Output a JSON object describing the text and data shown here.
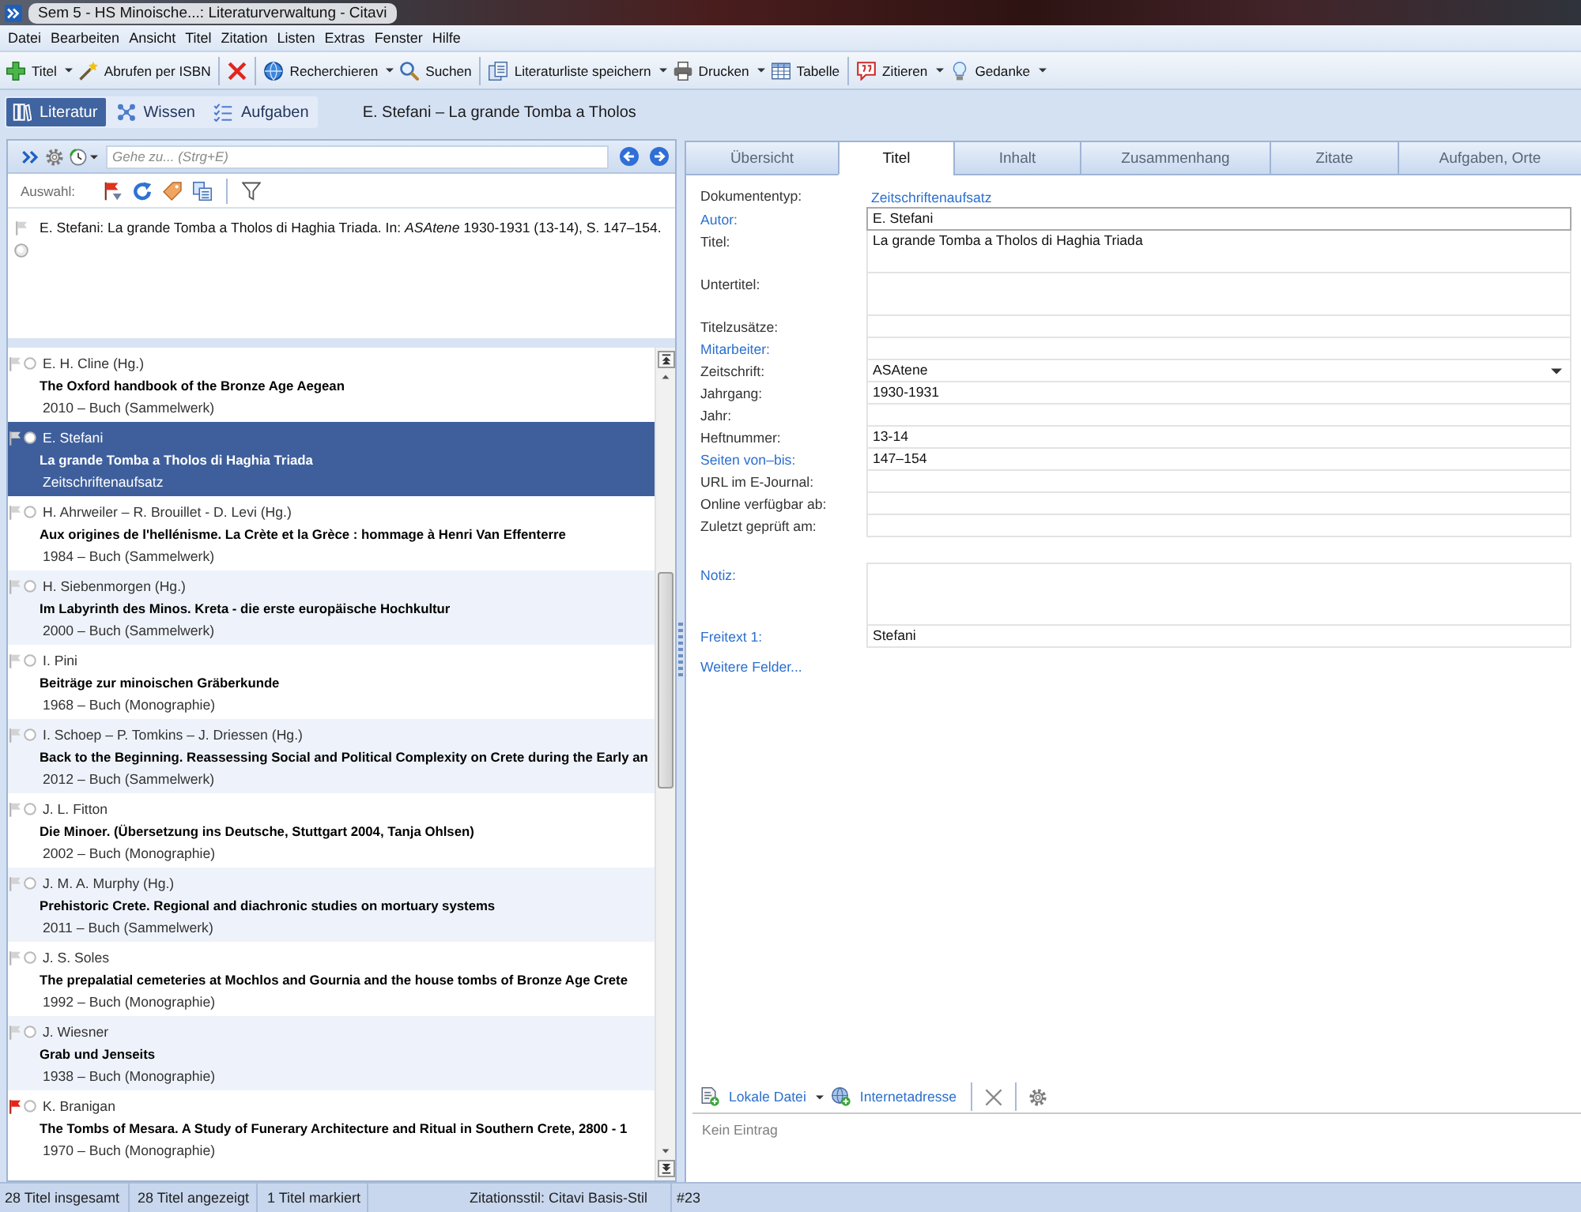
{
  "window": {
    "title": "Sem 5 - HS Minoische...: Literaturverwaltung - Citavi"
  },
  "menu": [
    "Datei",
    "Bearbeiten",
    "Ansicht",
    "Titel",
    "Zitation",
    "Listen",
    "Extras",
    "Fenster",
    "Hilfe"
  ],
  "toolbar": {
    "groups": [
      [
        {
          "label": "Titel",
          "dropdown": true
        },
        {
          "label": "Abrufen per ISBN",
          "dropdown": false
        }
      ],
      [
        {
          "dropdown": false
        }
      ],
      [
        {
          "label": "Recherchieren",
          "dropdown": true
        },
        {
          "label": "Suchen",
          "dropdown": false
        }
      ],
      [
        {
          "label": "Literaturliste speichern",
          "dropdown": true
        },
        {
          "label": "Drucken",
          "dropdown": true
        },
        {
          "label": "Tabelle",
          "dropdown": false
        }
      ],
      [
        {
          "label": "Zitieren",
          "dropdown": true
        },
        {
          "label": "Gedanke",
          "dropdown": true
        }
      ]
    ]
  },
  "modes": [
    {
      "label": "Literatur",
      "selected": true
    },
    {
      "label": "Wissen",
      "selected": false
    },
    {
      "label": "Aufgaben",
      "selected": false
    }
  ],
  "current_title": "E. Stefani – La grande Tomba a Tholos",
  "reference_list": {
    "search": {
      "placeholder": "Gehe zu... (Strg+E)"
    },
    "selection_label": "Auswahl:",
    "citation_preview": "E. Stefani: La grande Tomba a Tholos di Haghia Triada. In: *ASAtene* 1930-1931 (13-14), S. 147–154.",
    "items": [
      {
        "author": "E. H. Cline (Hg.)",
        "title": "The Oxford handbook of the Bronze Age Aegean",
        "info": "2010 – Buch (Sammelwerk)",
        "flagged": false,
        "selected": false
      },
      {
        "author": "E. Stefani",
        "title": "La grande Tomba a Tholos di Haghia Triada",
        "info": "Zeitschriftenaufsatz",
        "flagged": false,
        "selected": true
      },
      {
        "author": "H. Ahrweiler – R. Brouillet - D. Levi (Hg.)",
        "title": "Aux origines de l'hellénisme. La Crète et la Grèce : hommage à Henri Van Effenterre",
        "info": "1984 – Buch (Sammelwerk)",
        "flagged": false,
        "selected": false
      },
      {
        "author": "H. Siebenmorgen (Hg.)",
        "title": "Im Labyrinth des Minos. Kreta - die erste europäische Hochkultur",
        "info": "2000 – Buch (Sammelwerk)",
        "flagged": false,
        "selected": false
      },
      {
        "author": "I. Pini",
        "title": "Beiträge zur minoischen Gräberkunde",
        "info": "1968 – Buch (Monographie)",
        "flagged": false,
        "selected": false
      },
      {
        "author": "I. Schoep – P. Tomkins – J. Driessen (Hg.)",
        "title": "Back to the Beginning. Reassessing Social and Political Complexity on Crete during the Early an",
        "info": "2012 – Buch (Sammelwerk)",
        "flagged": false,
        "selected": false
      },
      {
        "author": "J. L. Fitton",
        "title": "Die Minoer. (Übersetzung ins Deutsche, Stuttgart 2004, Tanja Ohlsen)",
        "info": "2002 – Buch (Monographie)",
        "flagged": false,
        "selected": false
      },
      {
        "author": "J. M. A. Murphy (Hg.)",
        "title": "Prehistoric Crete. Regional and diachronic studies on mortuary systems",
        "info": "2011 – Buch (Sammelwerk)",
        "flagged": false,
        "selected": false
      },
      {
        "author": "J. S. Soles",
        "title": "The prepalatial cemeteries at Mochlos and Gournia and the house tombs of Bronze Age Crete",
        "info": "1992 – Buch (Monographie)",
        "flagged": false,
        "selected": false
      },
      {
        "author": "J. Wiesner",
        "title": "Grab und Jenseits",
        "info": "1938 – Buch (Monographie)",
        "flagged": false,
        "selected": false
      },
      {
        "author": "K. Branigan",
        "title": "The Tombs of Mesara. A Study of Funerary Architecture and Ritual in Southern Crete, 2800 - 1",
        "info": "1970 – Buch (Monographie)",
        "flagged": true,
        "selected": false
      }
    ]
  },
  "detail": {
    "tabs": [
      {
        "label": "Übersicht",
        "selected": false
      },
      {
        "label": "Titel",
        "selected": true
      },
      {
        "label": "Inhalt",
        "selected": false
      },
      {
        "label": "Zusammenhang",
        "selected": false
      },
      {
        "label": "Zitate",
        "selected": false
      },
      {
        "label": "Aufgaben, Orte",
        "selected": false
      }
    ],
    "fields": [
      {
        "label": "Dokumententyp:",
        "label_link": false,
        "kind": "type",
        "value": "Zeitschriftenaufsatz"
      },
      {
        "label": "Autor:",
        "label_link": true,
        "kind": "text",
        "value": "E. Stefani",
        "focused": true
      },
      {
        "label": "Titel:",
        "label_link": false,
        "kind": "multiline",
        "value": "La grande Tomba a Tholos di Haghia Triada",
        "focused": false
      },
      {
        "label": "Untertitel:",
        "label_link": false,
        "kind": "multiline",
        "focused": false
      },
      {
        "label": "Titelzusätze:",
        "label_link": false,
        "kind": "text",
        "focused": false
      },
      {
        "label": "Mitarbeiter:",
        "label_link": true,
        "kind": "text",
        "focused": false
      },
      {
        "label": "Zeitschrift:",
        "label_link": false,
        "kind": "dropdown",
        "value": "ASAtene",
        "focused": false
      },
      {
        "label": "Jahrgang:",
        "label_link": false,
        "kind": "text",
        "value": "1930-1931",
        "focused": false
      },
      {
        "label": "Jahr:",
        "label_link": false,
        "kind": "text",
        "focused": false
      },
      {
        "label": "Heftnummer:",
        "label_link": false,
        "kind": "text",
        "value": "13-14",
        "focused": false
      },
      {
        "label": "Seiten von–bis:",
        "label_link": true,
        "kind": "text",
        "value": "147–154",
        "focused": false
      },
      {
        "label": "URL im E-Journal:",
        "label_link": false,
        "kind": "text",
        "focused": false
      },
      {
        "label": "Online verfügbar ab:",
        "label_link": false,
        "kind": "text",
        "focused": false
      },
      {
        "label": "Zuletzt geprüft am:",
        "label_link": false,
        "kind": "text",
        "focused": false
      },
      {
        "label": "Notiz:",
        "label_link": true,
        "kind": "note",
        "focused": false
      },
      {
        "label": "Freitext 1:",
        "label_link": true,
        "kind": "text",
        "value": "Stefani",
        "focused": false
      }
    ],
    "more_fields": "Weitere Felder...",
    "attachments": {
      "toolbar": [
        {
          "label": "Lokale Datei",
          "dropdown": true
        },
        {
          "label": "Internetadresse",
          "dropdown": false
        }
      ],
      "empty_text": "Kein Eintrag"
    }
  },
  "status_bar": [
    "28 Titel insgesamt",
    "28 Titel angezeigt",
    "1 Titel markiert",
    "Zitationsstil: Citavi Basis-Stil",
    "#23"
  ]
}
